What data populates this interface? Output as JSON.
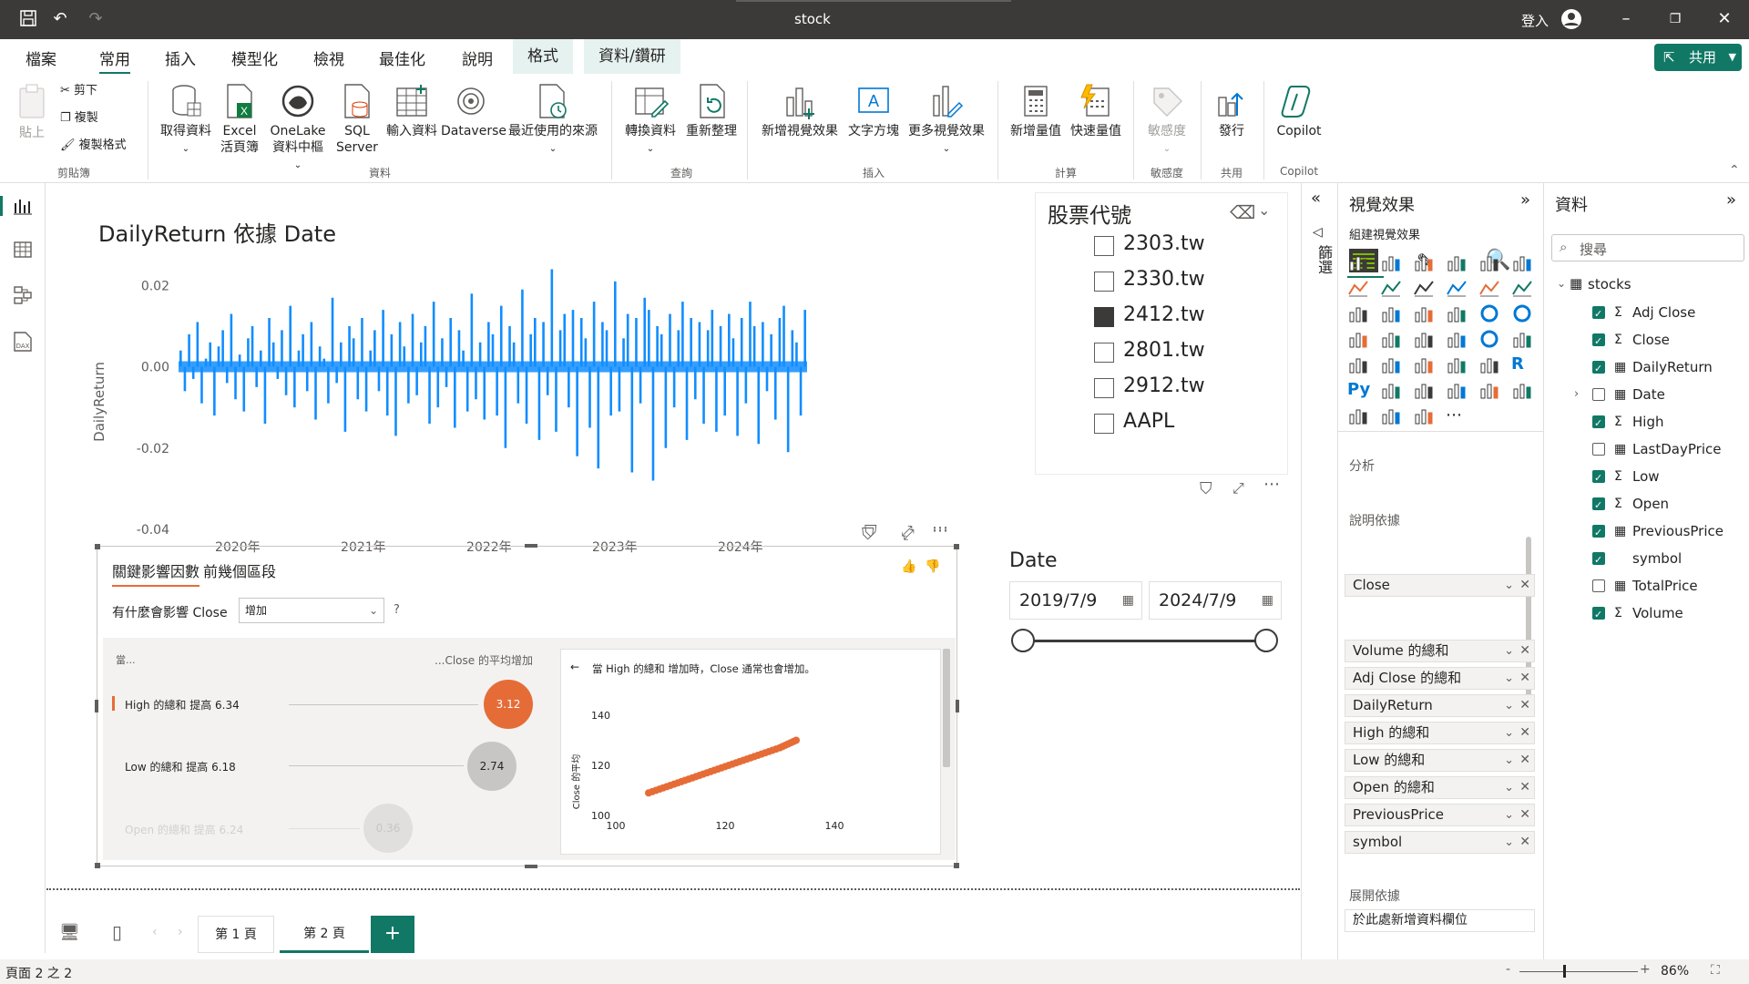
{
  "window": {
    "title": "stock",
    "user_label": "登入"
  },
  "menu": {
    "tabs": [
      "檔案",
      "常用",
      "插入",
      "模型化",
      "檢視",
      "最佳化",
      "說明",
      "格式",
      "資料/鑽研"
    ],
    "active": "常用",
    "share_label": "共用"
  },
  "ribbon": {
    "paste": "貼上",
    "cut": "剪下",
    "copy": "複製",
    "format_painter": "複製格式",
    "get_data": "取得資料",
    "excel_1": "Excel",
    "excel_2": "活頁簿",
    "onelake_1": "OneLake",
    "onelake_2": "資料中樞",
    "sql_1": "SQL",
    "sql_2": "Server",
    "enter_data": "輸入資料",
    "dataverse": "Dataverse",
    "recent_sources": "最近使用的來源",
    "transform_data": "轉換資料",
    "refresh": "重新整理",
    "new_visual": "新增視覺效果",
    "text_box": "文字方塊",
    "more_visuals": "更多視覺效果",
    "new_measure": "新增量值",
    "quick_measure": "快速量值",
    "sensitivity": "敏感度",
    "publish": "發行",
    "copilot": "Copilot",
    "groups": {
      "clipboard": "剪貼簿",
      "data": "資料",
      "queries": "查詢",
      "insert": "插入",
      "calculations": "計算",
      "sensitivity": "敏感度",
      "share": "共用",
      "copilot": "Copilot"
    }
  },
  "chart": {
    "title": "DailyReturn 依據 Date",
    "ylabel": "DailyReturn",
    "yticks": [
      "0.02",
      "0.00",
      "-0.02",
      "-0.04"
    ],
    "xticks": [
      "2020年",
      "2021年",
      "2022年",
      "2023年",
      "2024年"
    ]
  },
  "chart_data": {
    "type": "bar",
    "title": "DailyReturn 依據 Date",
    "ylabel": "DailyReturn",
    "xlabel": "",
    "x_range": [
      "2019-07-09",
      "2024-07-09"
    ],
    "ylim": [
      -0.04,
      0.025
    ],
    "series": [
      {
        "name": "DailyReturn",
        "color": "#118dff",
        "values": [
          0.004,
          -0.006,
          0.008,
          -0.003,
          0.011,
          -0.009,
          0.002,
          0.006,
          -0.012,
          0.005,
          0.009,
          -0.004,
          0.013,
          -0.008,
          0.003,
          -0.011,
          0.007,
          0.01,
          -0.005,
          0.004,
          -0.014,
          0.012,
          0.006,
          -0.003,
          0.009,
          -0.007,
          0.015,
          -0.01,
          0.004,
          0.008,
          -0.006,
          0.011,
          -0.013,
          0.005,
          0.002,
          -0.009,
          0.017,
          -0.004,
          0.006,
          -0.016,
          0.01,
          0.007,
          -0.008,
          0.012,
          -0.011,
          0.004,
          0.009,
          -0.006,
          0.014,
          -0.012,
          0.008,
          -0.017,
          0.011,
          0.005,
          -0.009,
          0.013,
          -0.007,
          0.006,
          0.01,
          -0.014,
          0.016,
          -0.01,
          0.007,
          -0.005,
          0.012,
          -0.015,
          0.009,
          0.004,
          -0.011,
          0.018,
          -0.008,
          0.006,
          -0.013,
          0.011,
          0.008,
          -0.012,
          0.015,
          -0.02,
          0.01,
          0.006,
          -0.009,
          0.019,
          -0.014,
          0.008,
          0.012,
          -0.018,
          0.011,
          -0.007,
          0.024,
          -0.016,
          0.009,
          0.013,
          -0.01,
          0.014,
          -0.022,
          0.012,
          0.007,
          -0.015,
          0.016,
          -0.025,
          0.011,
          0.009,
          -0.012,
          0.021,
          -0.011,
          0.007,
          0.013,
          -0.026,
          0.012,
          -0.009,
          0.017,
          0.014,
          -0.028,
          0.01,
          0.008,
          -0.02,
          0.013,
          -0.01,
          0.009,
          0.016,
          -0.018,
          0.012,
          -0.008,
          0.011,
          -0.014,
          0.009,
          0.014,
          -0.016,
          0.01,
          -0.012,
          0.013,
          0.007,
          -0.017,
          0.012,
          -0.009,
          0.016,
          0.01,
          -0.019,
          0.011,
          -0.006,
          0.008,
          -0.013,
          0.012,
          0.015,
          -0.021,
          0.009,
          0.006,
          -0.012,
          0.014
        ]
      }
    ]
  },
  "slicer_stock": {
    "title": "股票代號",
    "items": [
      "2303.tw",
      "2330.tw",
      "2412.tw",
      "2801.tw",
      "2912.tw",
      "AAPL"
    ],
    "selected": "2412.tw"
  },
  "slicer_date": {
    "title": "Date",
    "start": "2019/7/9",
    "end": "2024/7/9"
  },
  "key_influencers": {
    "tab_1": "關鍵影響因數",
    "tab_2": "前幾個區段",
    "question": "有什麼會影響 Close",
    "dropdown_value": "增加",
    "help": "?",
    "left_header": "當...",
    "right_header": "...Close 的平均增加",
    "rows": [
      {
        "label": "High 的總和 提高 6.34",
        "value": "3.12"
      },
      {
        "label": "Low 的總和 提高 6.18",
        "value": "2.74"
      },
      {
        "label": "Open 的總和 提高 6.24",
        "value": "0.36"
      }
    ],
    "detail_title": "當 High 的總和 增加時，Close 通常也會增加。",
    "detail_ylabel": "Close 的平均",
    "detail_yticks": [
      "140",
      "120",
      "100"
    ],
    "detail_xticks": [
      "100",
      "120",
      "140"
    ],
    "detail_points": [
      [
        106,
        109
      ],
      [
        110,
        112
      ],
      [
        114,
        115
      ],
      [
        118,
        118
      ],
      [
        122,
        121
      ],
      [
        126,
        124
      ],
      [
        130,
        127
      ],
      [
        133,
        130
      ]
    ]
  },
  "pages": {
    "items": [
      "第 1 頁",
      "第 2 頁"
    ],
    "active": "第 2 頁",
    "add": "+"
  },
  "status": {
    "page": "頁面 2 之 2",
    "zoom": "86%"
  },
  "filters_label": "篩選",
  "viz_pane": {
    "title": "視覺效果",
    "build": "組建視覺效果",
    "analyze": "分析",
    "analyze_field": "Close",
    "explain": "說明依據",
    "explain_fields": [
      "Volume 的總和",
      "Adj Close 的總和",
      "DailyReturn",
      "High 的總和",
      "Low 的總和",
      "Open 的總和",
      "PreviousPrice",
      "symbol"
    ],
    "expand": "展開依據",
    "expand_placeholder": "於此處新增資料欄位"
  },
  "data_pane": {
    "title": "資料",
    "search_placeholder": "搜尋",
    "table": "stocks",
    "fields": [
      {
        "name": "Adj Close",
        "checked": true,
        "sigma": true
      },
      {
        "name": "Close",
        "checked": true,
        "sigma": true
      },
      {
        "name": "DailyReturn",
        "checked": true,
        "sigma": false
      },
      {
        "name": "Date",
        "checked": false,
        "sigma": false
      },
      {
        "name": "High",
        "checked": true,
        "sigma": true
      },
      {
        "name": "LastDayPrice",
        "checked": false,
        "sigma": false
      },
      {
        "name": "Low",
        "checked": true,
        "sigma": true
      },
      {
        "name": "Open",
        "checked": true,
        "sigma": true
      },
      {
        "name": "PreviousPrice",
        "checked": true,
        "sigma": false
      },
      {
        "name": "symbol",
        "checked": true,
        "sigma": false
      },
      {
        "name": "TotalPrice",
        "checked": false,
        "sigma": false
      },
      {
        "name": "Volume",
        "checked": true,
        "sigma": true
      }
    ]
  }
}
